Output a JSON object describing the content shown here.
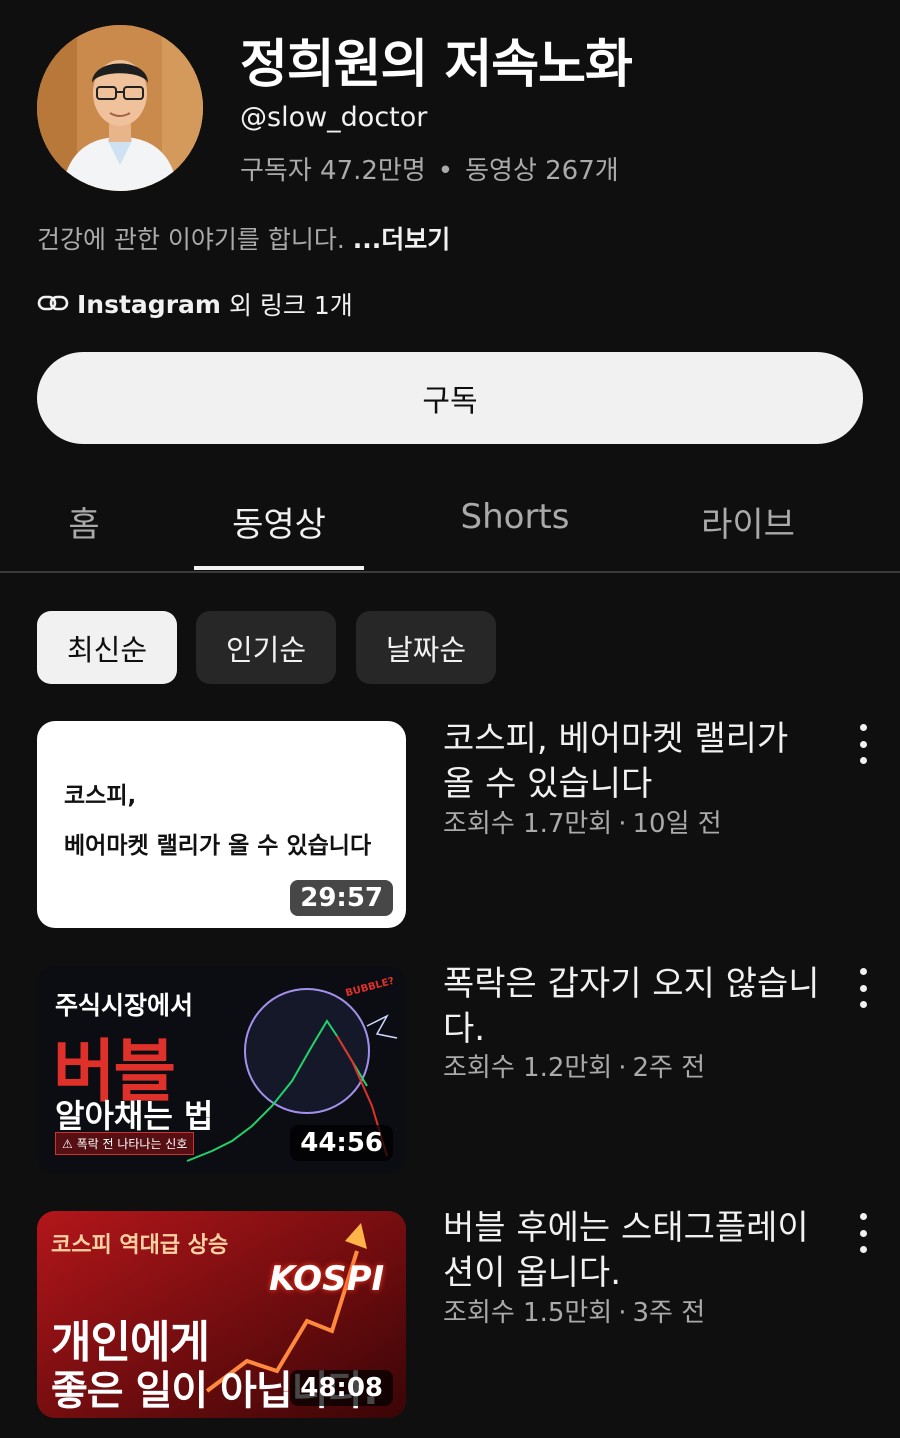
{
  "channel": {
    "name": "정희원의 저속노화",
    "handle": "@slow_doctor",
    "subscribers": "구독자 47.2만명",
    "videos_count": "동영상 267개",
    "stats_separator": "•",
    "description": "건강에 관한 이야기를 합니다. ",
    "more_label": "...더보기",
    "link_main": "Instagram",
    "link_rest": "외 링크 1개",
    "subscribe_label": "구독"
  },
  "tabs": [
    {
      "label": "홈",
      "active": false
    },
    {
      "label": "동영상",
      "active": true
    },
    {
      "label": "Shorts",
      "active": false
    },
    {
      "label": "라이브",
      "active": false
    }
  ],
  "chips": [
    {
      "label": "최신순",
      "selected": true
    },
    {
      "label": "인기순",
      "selected": false
    },
    {
      "label": "날짜순",
      "selected": false
    }
  ],
  "videos": [
    {
      "title": "코스피, 베어마켓 랠리가 올 수 있습니다",
      "views": "조회수 1.7만회",
      "age": "10일 전",
      "duration": "29:57",
      "thumb_text": [
        "코스피,",
        "베어마켓 랠리가 올 수 있습니다"
      ]
    },
    {
      "title": "폭락은 갑자기 오지 않습니다.",
      "views": "조회수 1.2만회",
      "age": "2주 전",
      "duration": "44:56",
      "thumb_text": [
        "주식시장에서",
        "버블",
        "알아채는 법",
        "⚠ 폭락 전 나타나는 신호",
        "BUBBLE?"
      ]
    },
    {
      "title": "버블 후에는 스태그플레이션이 옵니다.",
      "views": "조회수 1.5만회",
      "age": "3주 전",
      "duration": "48:08",
      "thumb_text": [
        "코스피 역대급 상승",
        "KOSPI",
        "개인에게",
        "좋은 일이 아닙니다."
      ]
    }
  ],
  "meta_separator": "·",
  "icons": {
    "link": "link-icon",
    "more_actions": "more-vert-icon"
  },
  "colors": {
    "background": "#0f0f0f",
    "text_primary": "#f1f1f1",
    "text_secondary": "#aaaaaa",
    "chip_bg": "#272727",
    "subscribe_bg": "#f1f1f1"
  }
}
